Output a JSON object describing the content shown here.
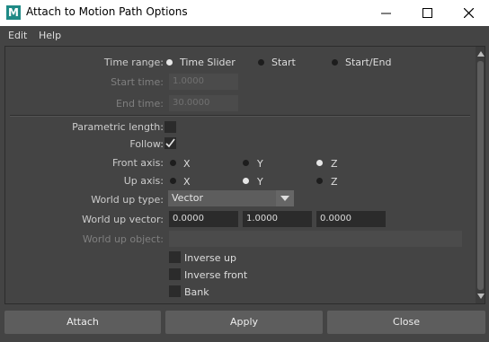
{
  "window": {
    "logo_letter": "M",
    "title": "Attach to Motion Path Options"
  },
  "menu": {
    "items": [
      "Edit",
      "Help"
    ]
  },
  "options": {
    "time_range": {
      "label": "Time range:",
      "choices": [
        "Time Slider",
        "Start",
        "Start/End"
      ],
      "selected": "Time Slider"
    },
    "start_time": {
      "label": "Start time:",
      "value": "1.0000"
    },
    "end_time": {
      "label": "End time:",
      "value": "30.0000"
    },
    "parametric_length": {
      "label": "Parametric length:",
      "checked": false
    },
    "follow": {
      "label": "Follow:",
      "checked": true
    },
    "front_axis": {
      "label": "Front axis:",
      "choices": [
        "X",
        "Y",
        "Z"
      ],
      "selected": "Z"
    },
    "up_axis": {
      "label": "Up axis:",
      "choices": [
        "X",
        "Y",
        "Z"
      ],
      "selected": "Y"
    },
    "world_up_type": {
      "label": "World up type:",
      "value": "Vector"
    },
    "world_up_vector": {
      "label": "World up vector:",
      "values": [
        "0.0000",
        "1.0000",
        "0.0000"
      ]
    },
    "world_up_object": {
      "label": "World up object:",
      "value": ""
    },
    "inverse_up": {
      "label": "Inverse up",
      "checked": false
    },
    "inverse_front": {
      "label": "Inverse front",
      "checked": false
    },
    "bank": {
      "label": "Bank",
      "checked": false
    }
  },
  "buttons": {
    "attach": "Attach",
    "apply": "Apply",
    "close": "Close"
  }
}
